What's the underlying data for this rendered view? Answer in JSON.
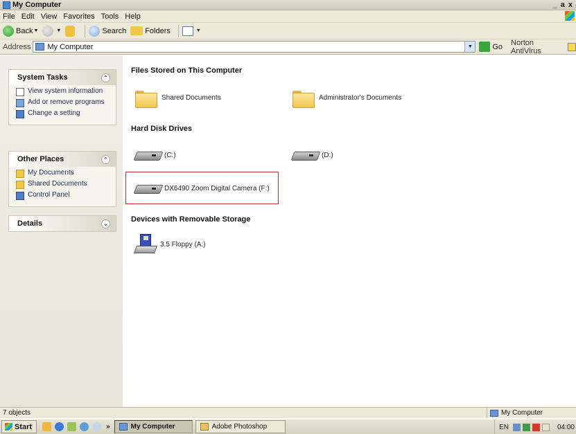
{
  "window": {
    "title": "My Computer",
    "controls": "_ а х"
  },
  "menu": [
    "File",
    "Edit",
    "View",
    "Favorites",
    "Tools",
    "Help"
  ],
  "toolbar": {
    "back": "Back",
    "search": "Search",
    "folders": "Folders"
  },
  "address": {
    "label": "Address",
    "value": "My Computer",
    "go": "Go",
    "norton": "Norton AntiVirus"
  },
  "tasks": {
    "system_tasks": {
      "title": "System Tasks",
      "items": [
        "View system information",
        "Add or remove programs",
        "Change a setting"
      ]
    },
    "other_places": {
      "title": "Other Places",
      "items": [
        "My Documents",
        "Shared Documents",
        "Control Panel"
      ]
    },
    "details": {
      "title": "Details"
    }
  },
  "content": {
    "files_section": "Files Stored on This Computer",
    "shared_docs": "Shared Documents",
    "admin_docs": "Administrator's Documents",
    "hdd_section": "Hard Disk Drives",
    "drive_c": "(C:)",
    "drive_d": "(D:)",
    "camera": "DX6490 Zoom Digital Camera (F:)",
    "removable_section": "Devices with Removable Storage",
    "floppy": "3.5 Floppy (A:)"
  },
  "status": {
    "count": "7 objects",
    "zone": "My Computer"
  },
  "taskbar": {
    "start": "Start",
    "more": "»",
    "tasks": [
      "My Computer",
      "Adobe Photoshop"
    ],
    "lang": "EN",
    "clock": "04:00"
  }
}
